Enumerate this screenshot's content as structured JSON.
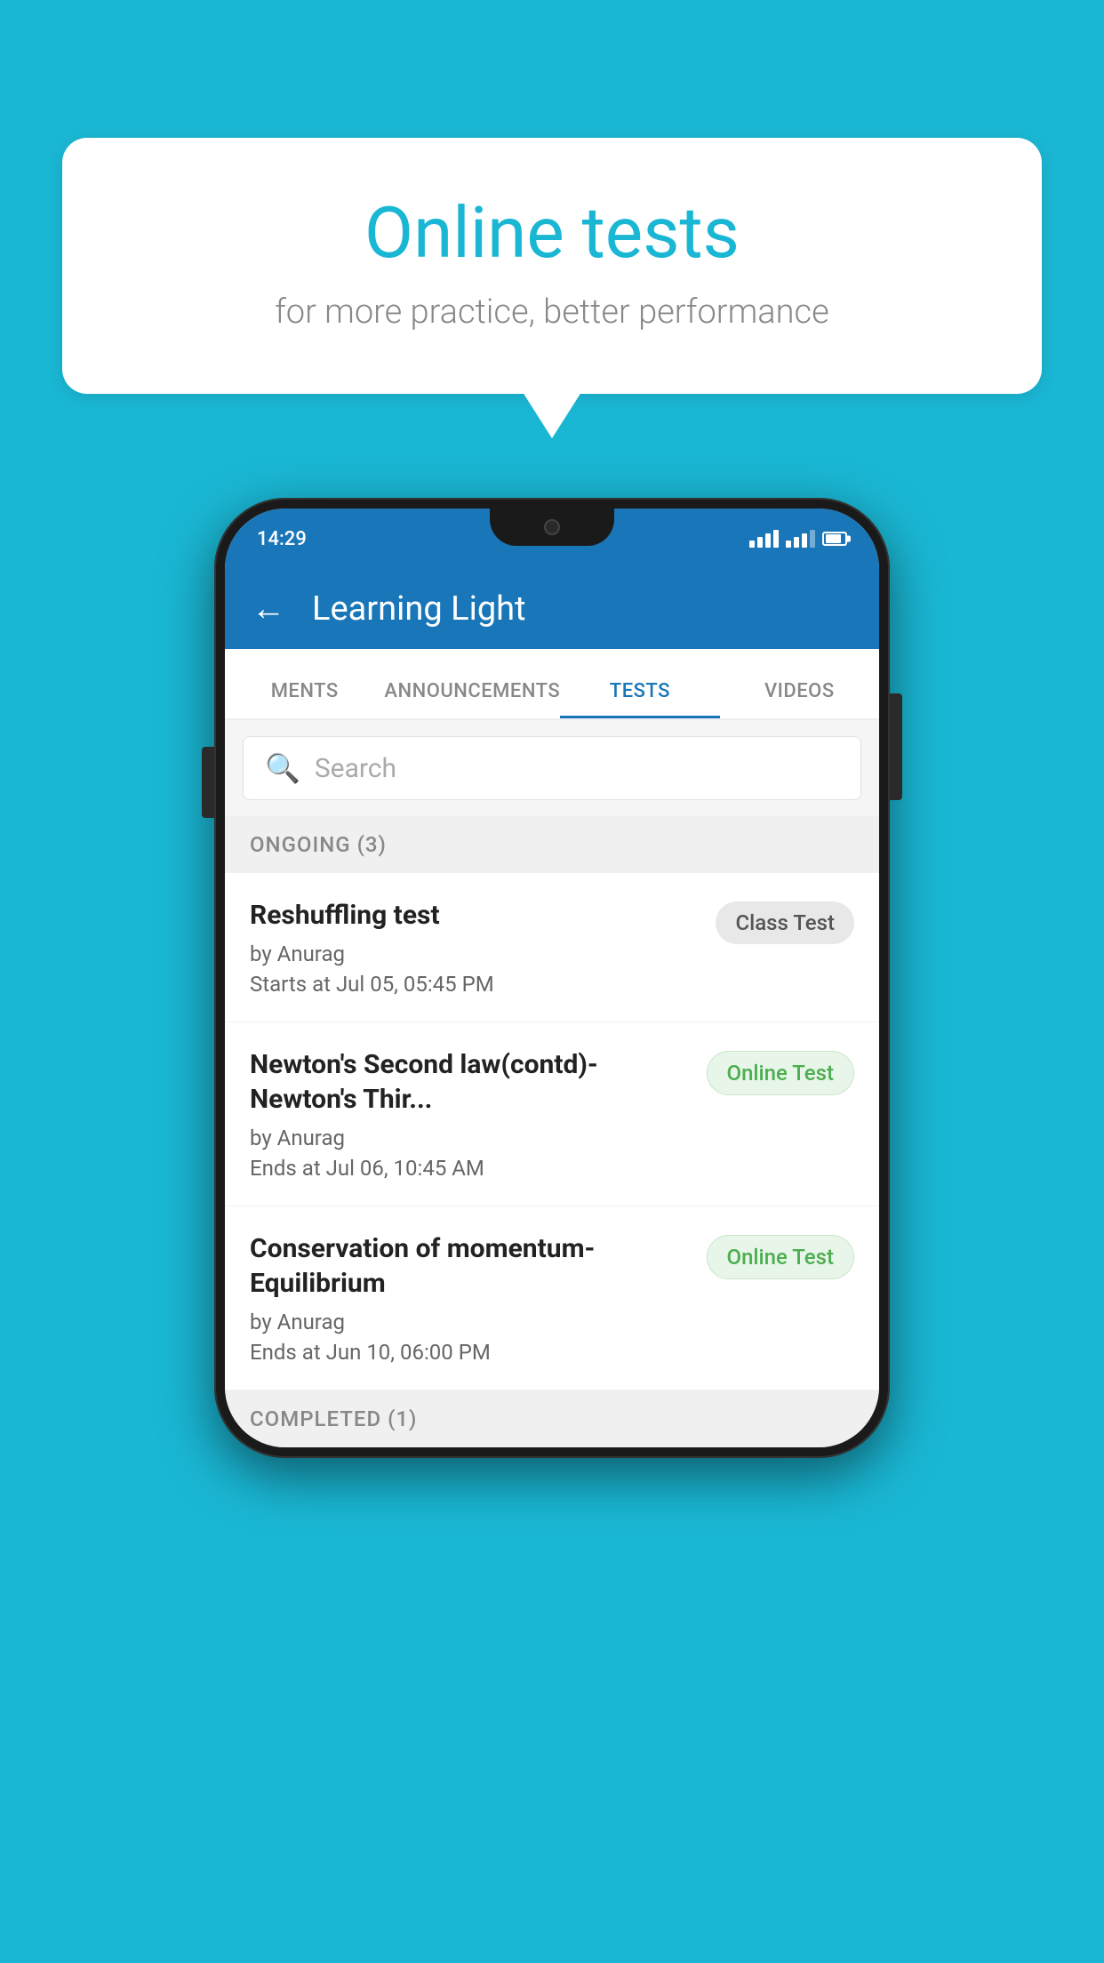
{
  "background_color": "#1ab7d4",
  "speech_bubble": {
    "title": "Online tests",
    "subtitle": "for more practice, better performance"
  },
  "phone": {
    "status_bar": {
      "time": "14:29"
    },
    "app_header": {
      "title": "Learning Light",
      "back_label": "←"
    },
    "tabs": [
      {
        "label": "MENTS",
        "active": false
      },
      {
        "label": "ANNOUNCEMENTS",
        "active": false
      },
      {
        "label": "TESTS",
        "active": true
      },
      {
        "label": "VIDEOS",
        "active": false
      }
    ],
    "search": {
      "placeholder": "Search"
    },
    "ongoing_section": {
      "label": "ONGOING (3)"
    },
    "tests": [
      {
        "title": "Reshuffling test",
        "author": "by Anurag",
        "date_label": "Starts at",
        "date": "Jul 05, 05:45 PM",
        "badge": "Class Test",
        "badge_type": "class"
      },
      {
        "title": "Newton's Second law(contd)-Newton's Thir...",
        "author": "by Anurag",
        "date_label": "Ends at",
        "date": "Jul 06, 10:45 AM",
        "badge": "Online Test",
        "badge_type": "online"
      },
      {
        "title": "Conservation of momentum-Equilibrium",
        "author": "by Anurag",
        "date_label": "Ends at",
        "date": "Jun 10, 06:00 PM",
        "badge": "Online Test",
        "badge_type": "online"
      }
    ],
    "completed_section": {
      "label": "COMPLETED (1)"
    }
  }
}
